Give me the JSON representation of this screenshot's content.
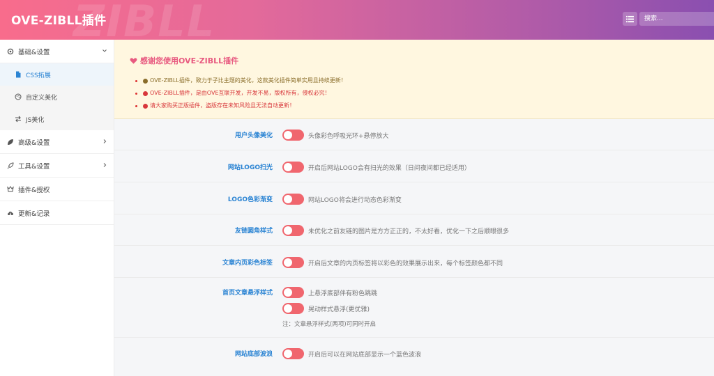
{
  "header": {
    "title": "OVE-ZIBLL插件",
    "watermark": "ZIBLL",
    "search_placeholder": "搜索..."
  },
  "sidebar": {
    "groups": [
      {
        "label": "基础&设置",
        "icon": "gear-icon",
        "expanded": true,
        "items": [
          {
            "label": "CSS拓展",
            "icon": "file-icon",
            "active": true
          },
          {
            "label": "自定义美化",
            "icon": "palette-icon",
            "active": false
          },
          {
            "label": "JS美化",
            "icon": "exchange-icon",
            "active": false
          }
        ]
      },
      {
        "label": "高级&设置",
        "icon": "leaf-icon"
      },
      {
        "label": "工具&设置",
        "icon": "rocket-icon"
      },
      {
        "label": "插件&授权",
        "icon": "key-icon"
      },
      {
        "label": "更新&记录",
        "icon": "cloud-download-icon"
      }
    ]
  },
  "notice": {
    "title": "感谢您使用OVE-ZIBLL插件",
    "lines": [
      "OVE-ZIBLL插件，致力于子比主题的美化，这款美化插件简单实用且持续更新！",
      "OVE-ZIBLL插件，是由OVE互联开发，开发不易，版权所有，侵权必究！",
      "请大家购买正版插件，盗版存在未知风险且无法自动更新！"
    ]
  },
  "settings": [
    {
      "label": "用户头像美化",
      "options": [
        "头像彩色呼吸光环+悬停放大"
      ],
      "note": ""
    },
    {
      "label": "网站LOGO扫光",
      "options": [
        "开启后网站LOGO会有扫光的效果（日间夜间都已经适用）"
      ],
      "note": ""
    },
    {
      "label": "LOGO色彩渐变",
      "options": [
        "网站LOGO将会进行动态色彩渐变"
      ],
      "note": ""
    },
    {
      "label": "友链圆角样式",
      "options": [
        "未优化之前友链的图片是方方正正的，不太好看，优化一下之后顺眼很多"
      ],
      "note": ""
    },
    {
      "label": "文章内页彩色标签",
      "options": [
        "开启后文章的内页标签将以彩色的效果展示出来，每个标签颜色都不同"
      ],
      "note": ""
    },
    {
      "label": "首页文章悬浮样式",
      "options": [
        "上悬浮底部伴有粉色跳跳",
        "晃动样式悬浮(更优雅)"
      ],
      "note": "注：文章悬浮样式(两项)可同时开启"
    },
    {
      "label": "网站底部波浪",
      "options": [
        "开启后可以在网站底部显示一个蓝色波浪"
      ],
      "note": ""
    }
  ],
  "colors": {
    "accent": "#2b84d3",
    "toggle_on": "#f0666e",
    "notice_title": "#e85a80",
    "notice_bg": "#fff7e0"
  }
}
